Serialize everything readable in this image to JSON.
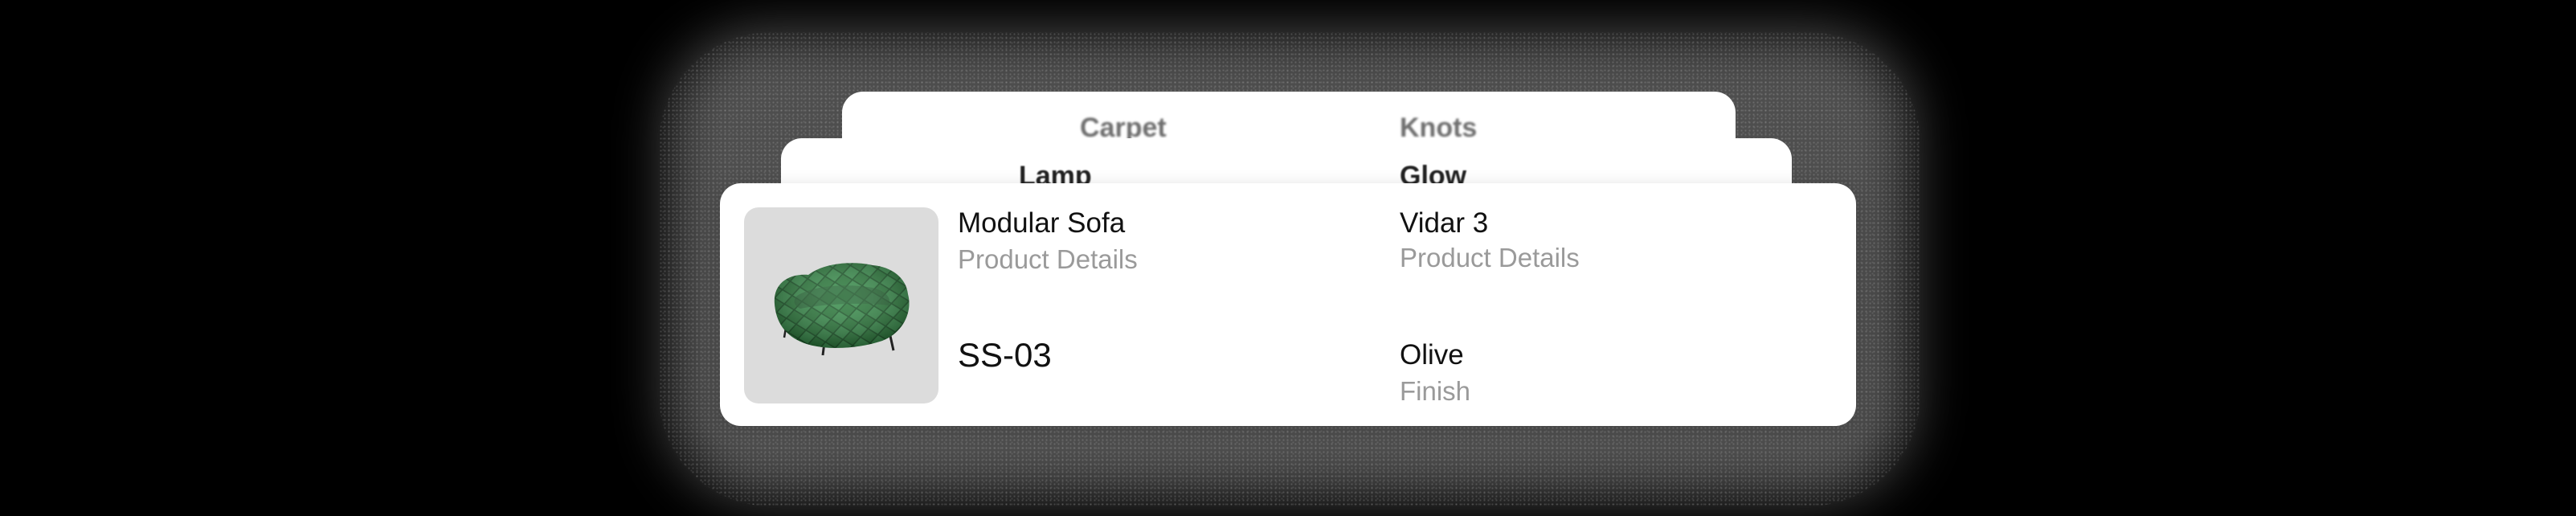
{
  "stack": {
    "back_card_2": {
      "left_label": "Carpet",
      "right_label": "Knots"
    },
    "back_card_1": {
      "left_label": "Lamp",
      "right_label": "Glow"
    }
  },
  "product_card": {
    "image_icon": "green-quilted-sofa",
    "name": "Modular Sofa",
    "name_caption": "Product Details",
    "sku": "SS-03",
    "model": "Vidar 3",
    "model_caption": "Product Details",
    "finish": "Olive",
    "finish_caption": "Finish"
  },
  "colors": {
    "background": "#000000",
    "card": "#ffffff",
    "thumbnail_bg": "#dcdcdc",
    "primary_text": "#111111",
    "secondary_text": "#9a9a9a",
    "sofa_green": "#2f7d3f"
  }
}
